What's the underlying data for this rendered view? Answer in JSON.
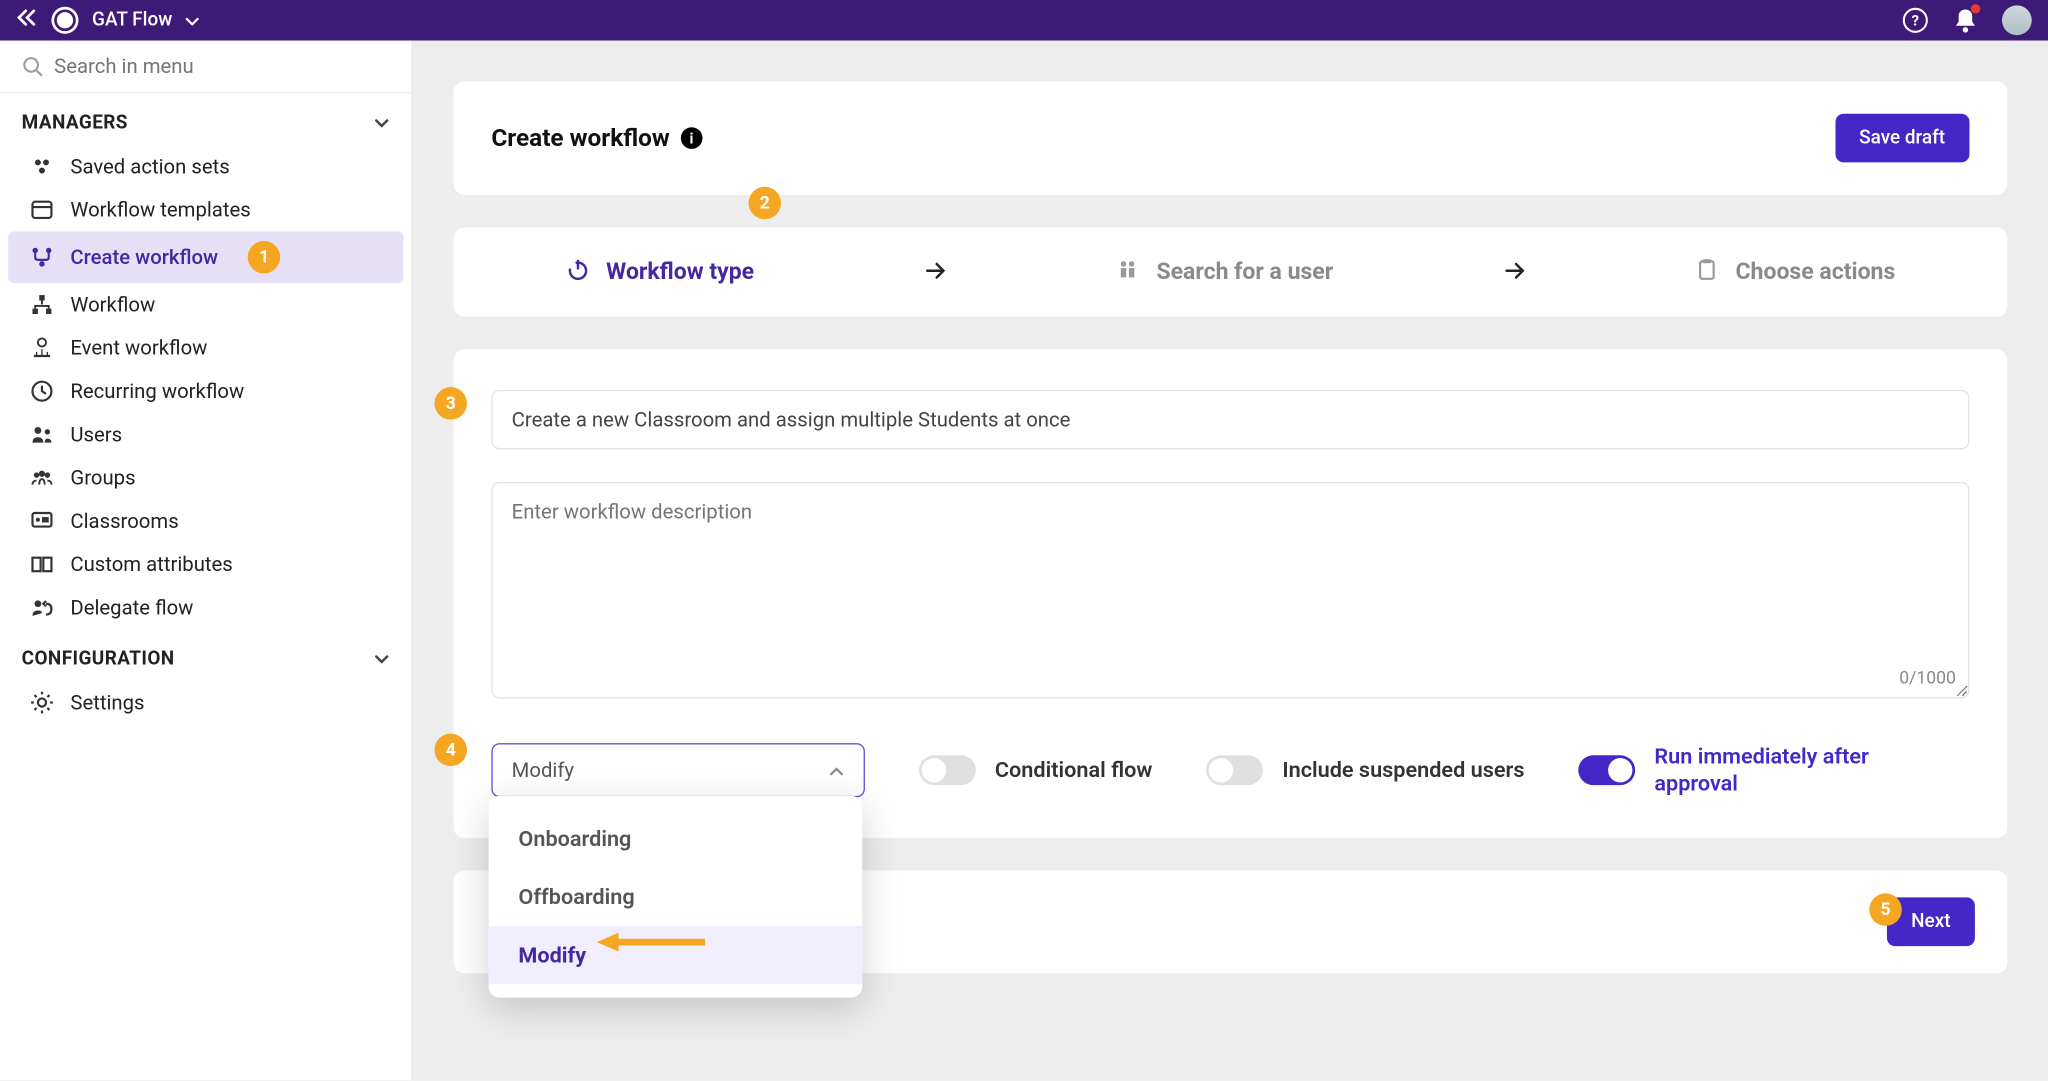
{
  "header": {
    "app_name": "GAT Flow"
  },
  "search": {
    "placeholder": "Search in menu"
  },
  "sidebar": {
    "section_managers": "MANAGERS",
    "section_config": "CONFIGURATION",
    "items": [
      {
        "label": "Saved action sets"
      },
      {
        "label": "Workflow templates"
      },
      {
        "label": "Create workflow"
      },
      {
        "label": "Workflow"
      },
      {
        "label": "Event workflow"
      },
      {
        "label": "Recurring workflow"
      },
      {
        "label": "Users"
      },
      {
        "label": "Groups"
      },
      {
        "label": "Classrooms"
      },
      {
        "label": "Custom attributes"
      },
      {
        "label": "Delegate flow"
      }
    ],
    "settings_label": "Settings"
  },
  "page": {
    "title": "Create workflow",
    "save_draft": "Save draft"
  },
  "stepper": {
    "step1": "Workflow type",
    "step2": "Search for a user",
    "step3": "Choose actions"
  },
  "form": {
    "name_value": "Create a new Classroom and assign multiple Students at once",
    "desc_placeholder": "Enter workflow description",
    "char_count": "0/1000",
    "select_value": "Modify",
    "conditional_label": "Conditional flow",
    "suspended_label": "Include suspended users",
    "run_label": "Run immediately after approval",
    "dropdown": {
      "opt1": "Onboarding",
      "opt2": "Offboarding",
      "opt3": "Modify"
    }
  },
  "footer": {
    "next": "Next"
  },
  "badges": {
    "b1": "1",
    "b2": "2",
    "b3": "3",
    "b4": "4",
    "b5": "5"
  }
}
